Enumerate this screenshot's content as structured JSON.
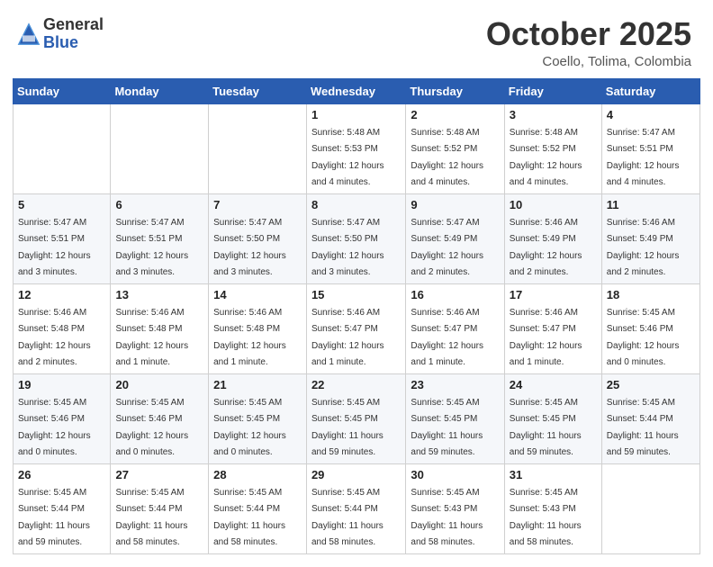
{
  "logo": {
    "general": "General",
    "blue": "Blue"
  },
  "title": "October 2025",
  "location": "Coello, Tolima, Colombia",
  "days_of_week": [
    "Sunday",
    "Monday",
    "Tuesday",
    "Wednesday",
    "Thursday",
    "Friday",
    "Saturday"
  ],
  "weeks": [
    [
      {
        "day": "",
        "info": ""
      },
      {
        "day": "",
        "info": ""
      },
      {
        "day": "",
        "info": ""
      },
      {
        "day": "1",
        "info": "Sunrise: 5:48 AM\nSunset: 5:53 PM\nDaylight: 12 hours\nand 4 minutes."
      },
      {
        "day": "2",
        "info": "Sunrise: 5:48 AM\nSunset: 5:52 PM\nDaylight: 12 hours\nand 4 minutes."
      },
      {
        "day": "3",
        "info": "Sunrise: 5:48 AM\nSunset: 5:52 PM\nDaylight: 12 hours\nand 4 minutes."
      },
      {
        "day": "4",
        "info": "Sunrise: 5:47 AM\nSunset: 5:51 PM\nDaylight: 12 hours\nand 4 minutes."
      }
    ],
    [
      {
        "day": "5",
        "info": "Sunrise: 5:47 AM\nSunset: 5:51 PM\nDaylight: 12 hours\nand 3 minutes."
      },
      {
        "day": "6",
        "info": "Sunrise: 5:47 AM\nSunset: 5:51 PM\nDaylight: 12 hours\nand 3 minutes."
      },
      {
        "day": "7",
        "info": "Sunrise: 5:47 AM\nSunset: 5:50 PM\nDaylight: 12 hours\nand 3 minutes."
      },
      {
        "day": "8",
        "info": "Sunrise: 5:47 AM\nSunset: 5:50 PM\nDaylight: 12 hours\nand 3 minutes."
      },
      {
        "day": "9",
        "info": "Sunrise: 5:47 AM\nSunset: 5:49 PM\nDaylight: 12 hours\nand 2 minutes."
      },
      {
        "day": "10",
        "info": "Sunrise: 5:46 AM\nSunset: 5:49 PM\nDaylight: 12 hours\nand 2 minutes."
      },
      {
        "day": "11",
        "info": "Sunrise: 5:46 AM\nSunset: 5:49 PM\nDaylight: 12 hours\nand 2 minutes."
      }
    ],
    [
      {
        "day": "12",
        "info": "Sunrise: 5:46 AM\nSunset: 5:48 PM\nDaylight: 12 hours\nand 2 minutes."
      },
      {
        "day": "13",
        "info": "Sunrise: 5:46 AM\nSunset: 5:48 PM\nDaylight: 12 hours\nand 1 minute."
      },
      {
        "day": "14",
        "info": "Sunrise: 5:46 AM\nSunset: 5:48 PM\nDaylight: 12 hours\nand 1 minute."
      },
      {
        "day": "15",
        "info": "Sunrise: 5:46 AM\nSunset: 5:47 PM\nDaylight: 12 hours\nand 1 minute."
      },
      {
        "day": "16",
        "info": "Sunrise: 5:46 AM\nSunset: 5:47 PM\nDaylight: 12 hours\nand 1 minute."
      },
      {
        "day": "17",
        "info": "Sunrise: 5:46 AM\nSunset: 5:47 PM\nDaylight: 12 hours\nand 1 minute."
      },
      {
        "day": "18",
        "info": "Sunrise: 5:45 AM\nSunset: 5:46 PM\nDaylight: 12 hours\nand 0 minutes."
      }
    ],
    [
      {
        "day": "19",
        "info": "Sunrise: 5:45 AM\nSunset: 5:46 PM\nDaylight: 12 hours\nand 0 minutes."
      },
      {
        "day": "20",
        "info": "Sunrise: 5:45 AM\nSunset: 5:46 PM\nDaylight: 12 hours\nand 0 minutes."
      },
      {
        "day": "21",
        "info": "Sunrise: 5:45 AM\nSunset: 5:45 PM\nDaylight: 12 hours\nand 0 minutes."
      },
      {
        "day": "22",
        "info": "Sunrise: 5:45 AM\nSunset: 5:45 PM\nDaylight: 11 hours\nand 59 minutes."
      },
      {
        "day": "23",
        "info": "Sunrise: 5:45 AM\nSunset: 5:45 PM\nDaylight: 11 hours\nand 59 minutes."
      },
      {
        "day": "24",
        "info": "Sunrise: 5:45 AM\nSunset: 5:45 PM\nDaylight: 11 hours\nand 59 minutes."
      },
      {
        "day": "25",
        "info": "Sunrise: 5:45 AM\nSunset: 5:44 PM\nDaylight: 11 hours\nand 59 minutes."
      }
    ],
    [
      {
        "day": "26",
        "info": "Sunrise: 5:45 AM\nSunset: 5:44 PM\nDaylight: 11 hours\nand 59 minutes."
      },
      {
        "day": "27",
        "info": "Sunrise: 5:45 AM\nSunset: 5:44 PM\nDaylight: 11 hours\nand 58 minutes."
      },
      {
        "day": "28",
        "info": "Sunrise: 5:45 AM\nSunset: 5:44 PM\nDaylight: 11 hours\nand 58 minutes."
      },
      {
        "day": "29",
        "info": "Sunrise: 5:45 AM\nSunset: 5:44 PM\nDaylight: 11 hours\nand 58 minutes."
      },
      {
        "day": "30",
        "info": "Sunrise: 5:45 AM\nSunset: 5:43 PM\nDaylight: 11 hours\nand 58 minutes."
      },
      {
        "day": "31",
        "info": "Sunrise: 5:45 AM\nSunset: 5:43 PM\nDaylight: 11 hours\nand 58 minutes."
      },
      {
        "day": "",
        "info": ""
      }
    ]
  ]
}
